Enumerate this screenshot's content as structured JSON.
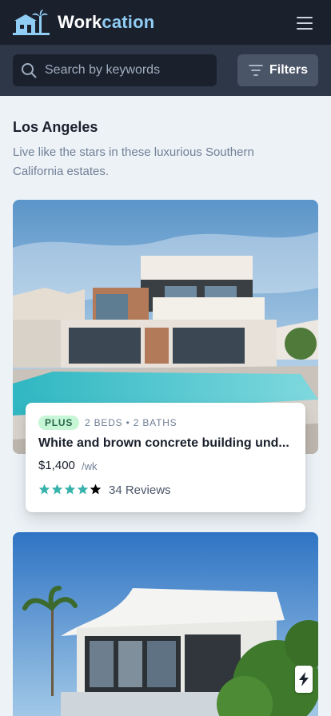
{
  "header": {
    "logo_part1": "Work",
    "logo_part2": "cation",
    "logo_icon": "house-palm-icon",
    "menu_icon": "hamburger-menu-icon"
  },
  "search": {
    "placeholder": "Search by keywords",
    "value": "",
    "icon": "search-icon"
  },
  "filters": {
    "label": "Filters",
    "icon": "filter-lines-icon"
  },
  "section": {
    "title": "Los Angeles",
    "description": "Live like the stars in these luxurious Southern California estates."
  },
  "listings": [
    {
      "badge": "Plus",
      "beds_baths": "2 beds • 2 baths",
      "title": "White and brown concrete building und...",
      "price": "$1,400",
      "price_unit": "/wk",
      "rating": 4,
      "max_rating": 5,
      "reviews": "34 Reviews"
    },
    {
      "quick_book_icon": "lightning-bolt-icon"
    }
  ],
  "colors": {
    "header_bg": "#1a202c",
    "searchbar_bg": "#2d3748",
    "accent_logo": "#90cdf4",
    "badge_bg": "#c6f6d5",
    "star_filled": "#38b2ac",
    "page_bg": "#edf2f7"
  }
}
